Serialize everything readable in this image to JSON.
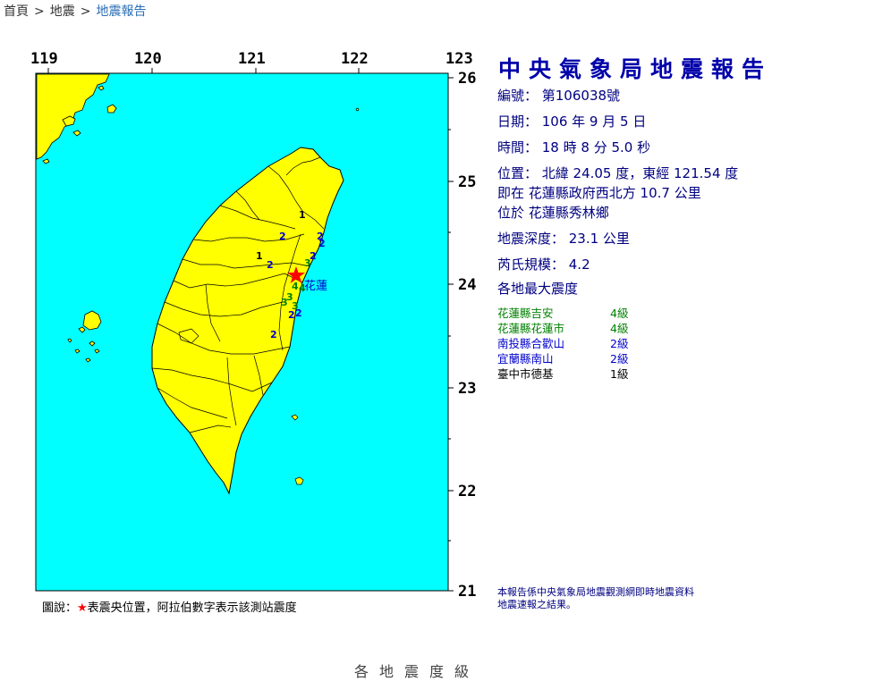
{
  "breadcrumb": {
    "items": [
      "首頁",
      "地震",
      "地震報告"
    ],
    "separator": ">"
  },
  "map": {
    "lon_labels": [
      "119",
      "120",
      "121",
      "122",
      "123"
    ],
    "lat_labels": [
      "26",
      "25",
      "24",
      "23",
      "22",
      "21"
    ],
    "sea_color": "#00ffff",
    "land_color": "#ffff00",
    "border_color": "#000000"
  },
  "epicenter": {
    "place_label": "花蓮",
    "star_color": "#ff0000"
  },
  "intensity_marks": [
    "1",
    "2",
    "2",
    "2",
    "1",
    "3",
    "4",
    "4",
    "3",
    "3",
    "3",
    "2",
    "2",
    "2",
    "2",
    "2"
  ],
  "report": {
    "title": "中央氣象局地震報告",
    "number_line": "編號： 第106038號",
    "date_line": "日期： 106 年 9 月 5 日",
    "time_line": "時間： 18 時 8 分 5.0 秒",
    "position_line": "位置： 北緯 24.05 度，東經 121.54 度",
    "located_at_line": "即在 花蓮縣政府西北方 10.7 公里",
    "located_in_line": "位於 花蓮縣秀林鄉",
    "depth_line": "地震深度： 23.1 公里",
    "magnitude_line": "芮氏規模： 4.2",
    "max_intensity_title": "各地最大震度"
  },
  "stations": [
    {
      "name": "花蓮縣吉安",
      "level": "4級",
      "color": "#008000"
    },
    {
      "name": "花蓮縣花蓮市",
      "level": "4級",
      "color": "#008000"
    },
    {
      "name": "南投縣合歡山",
      "level": "2級",
      "color": "#0000cc"
    },
    {
      "name": "宜蘭縣南山",
      "level": "2級",
      "color": "#0000cc"
    },
    {
      "name": "臺中市德基",
      "level": "1級",
      "color": "#000000"
    }
  ],
  "footnote": {
    "line1": "本報告係中央氣象局地震觀測網即時地震資料",
    "line2": "地震速報之結果。"
  },
  "legend": {
    "prefix": "圖說：",
    "star": "★",
    "text": "表震央位置，阿拉伯數字表示該測站震度"
  },
  "below_text": "各地震度級"
}
